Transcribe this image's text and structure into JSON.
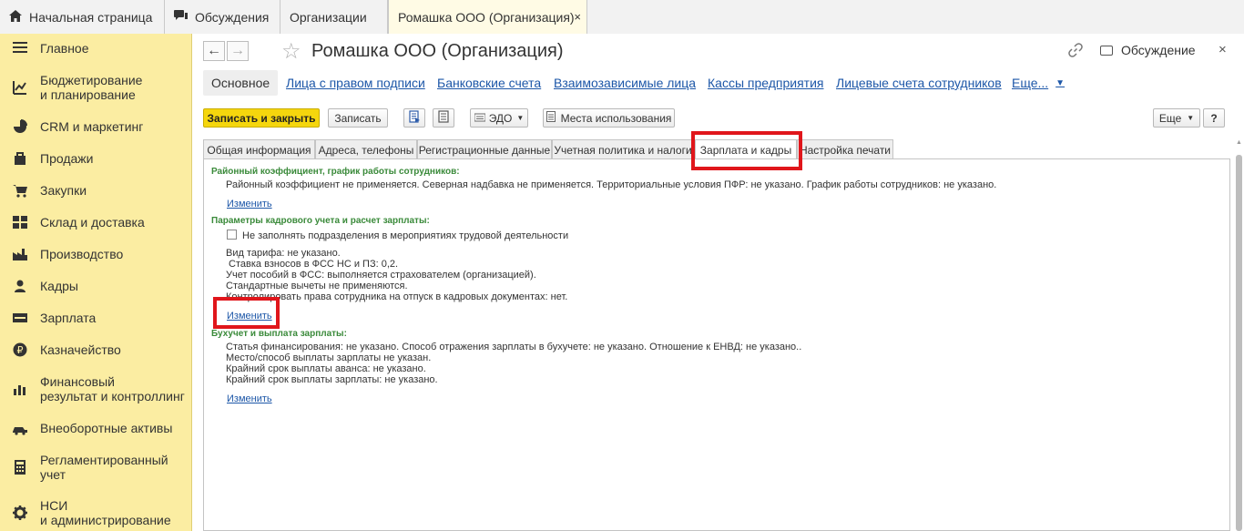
{
  "topbar": {
    "tabs": [
      {
        "label": "Начальная страница",
        "icon": "home-icon"
      },
      {
        "label": "Обсуждения",
        "icon": "discussion-icon"
      },
      {
        "label": "Организации"
      },
      {
        "label": "Ромашка ООО (Организация)",
        "close": "×"
      }
    ]
  },
  "sidebar": {
    "items": [
      {
        "label": "Главное",
        "icon": "menu-icon"
      },
      {
        "label": "Бюджетирование\nи планирование",
        "icon": "budget-icon"
      },
      {
        "label": "CRM и маркетинг",
        "icon": "crm-icon"
      },
      {
        "label": "Продажи",
        "icon": "sales-bag-icon"
      },
      {
        "label": "Закупки",
        "icon": "cart-icon"
      },
      {
        "label": "Склад и доставка",
        "icon": "warehouse-icon"
      },
      {
        "label": "Производство",
        "icon": "factory-icon"
      },
      {
        "label": "Кадры",
        "icon": "person-icon"
      },
      {
        "label": "Зарплата",
        "icon": "salary-icon"
      },
      {
        "label": "Казначейство",
        "icon": "ruble-icon"
      },
      {
        "label": "Финансовый\nрезультат и контроллинг",
        "icon": "bar-chart-icon"
      },
      {
        "label": "Внеоборотные активы",
        "icon": "assets-icon"
      },
      {
        "label": "Регламентированный\nучет",
        "icon": "calculator-icon"
      },
      {
        "label": "НСИ\nи администрирование",
        "icon": "gear-icon"
      }
    ]
  },
  "header": {
    "title": "Ромашка ООО (Организация)",
    "discussion_label": "Обсуждение",
    "back": "←",
    "forward": "→",
    "star": "☆",
    "close": "×"
  },
  "section_tabs": [
    {
      "label": "Основное"
    },
    {
      "label": "Лица с правом подписи"
    },
    {
      "label": "Банковские счета"
    },
    {
      "label": "Взаимозависимые лица"
    },
    {
      "label": "Кассы предприятия"
    },
    {
      "label": "Лицевые счета сотрудников"
    },
    {
      "label": "Еще..."
    }
  ],
  "toolbar": {
    "save_close": "Записать и закрыть",
    "save": "Записать",
    "edo": "ЭДО",
    "usage": "Места использования",
    "more": "Еще",
    "help": "?"
  },
  "form_tabs": [
    {
      "label": "Общая информация"
    },
    {
      "label": "Адреса, телефоны"
    },
    {
      "label": "Регистрационные данные"
    },
    {
      "label": "Учетная политика и налоги"
    },
    {
      "label": "Зарплата и кадры"
    },
    {
      "label": "Настройка печати"
    }
  ],
  "content": {
    "group1_title": "Районный коэффициент, график работы сотрудников:",
    "group1_text": "Районный коэффициент не применяется. Северная надбавка не применяется. Территориальные условия ПФР: не указано. График работы сотрудников: не указано.",
    "group1_link": "Изменить",
    "group2_title": "Параметры кадрового учета и расчет зарплаты:",
    "group2_checkbox": "Не заполнять подразделения в мероприятиях трудовой деятельности",
    "group2_lines": [
      "Вид тарифа: не указано.",
      " Ставка взносов в ФСС НС и ПЗ: 0,2.",
      "Учет пособий в ФСС: выполняется страхователем (организацией).",
      "Стандартные вычеты не применяются.",
      "Контролировать права сотрудника на отпуск в кадровых документах: нет."
    ],
    "group2_link": "Изменить",
    "group3_title": "Бухучет и выплата зарплаты:",
    "group3_lines": [
      "Статья финансирования: не указано. Способ отражения зарплаты в бухучете: не указано. Отношение к ЕНВД: не указано..",
      "Место/способ выплаты зарплаты не указан.",
      "Крайний срок выплаты аванса: не указано.",
      "Крайний срок выплаты зарплаты: не указано."
    ],
    "group3_link": "Изменить"
  },
  "colors": {
    "sidebar_bg": "#fbeda2",
    "primary_button": "#f5d60d",
    "link": "#1d57a8",
    "group_title": "#3a8a3a",
    "highlight": "#e0161b"
  }
}
